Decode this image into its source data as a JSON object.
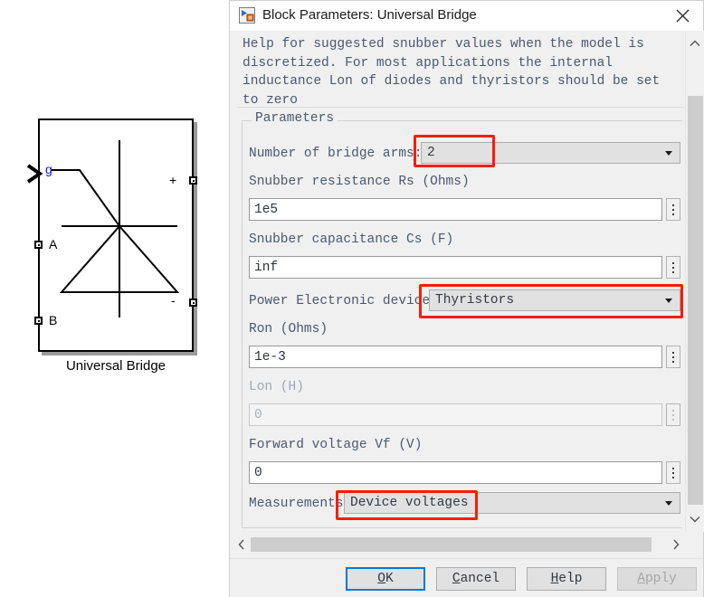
{
  "canvas": {
    "block": {
      "name": "Universal Bridge",
      "caption": "Universal Bridge",
      "ports": [
        {
          "label": "g",
          "type": "gate-input",
          "color": "#1111dd"
        },
        {
          "label": "A",
          "type": "ac-input"
        },
        {
          "label": "B",
          "type": "ac-input"
        },
        {
          "label": "+",
          "type": "dc-positive-output"
        },
        {
          "label": "-",
          "type": "dc-negative-output"
        }
      ],
      "symbol": "thyristor"
    }
  },
  "dialog": {
    "title": "Block Parameters: Universal Bridge",
    "title_icon": "simulink-block-icon",
    "close_icon": "close-icon",
    "help_text": "Help for suggested snubber values when the model is discretized. For most applications the internal inductance Lon of diodes and thyristors should be set to zero",
    "parameters_legend": "Parameters",
    "fields": {
      "bridge_arms": {
        "label": "Number of bridge arms:",
        "value": "2",
        "control": "dropdown",
        "highlighted": true
      },
      "snubber_resistance": {
        "label": "Snubber resistance Rs (Ohms)",
        "value": "1e5",
        "control": "text",
        "enabled": true
      },
      "snubber_capacitance": {
        "label": "Snubber capacitance Cs (F)",
        "value": "inf",
        "control": "text",
        "enabled": true
      },
      "power_electronic_device": {
        "label": "Power Electronic device",
        "value": "Thyristors",
        "control": "dropdown",
        "highlighted": true
      },
      "ron": {
        "label": "Ron (Ohms)",
        "value": "1e-3",
        "control": "text",
        "enabled": true
      },
      "lon": {
        "label": "Lon (H)",
        "value": "0",
        "control": "text",
        "enabled": false
      },
      "forward_voltage": {
        "label": "Forward voltage Vf (V)",
        "value": "0",
        "control": "text",
        "enabled": true
      },
      "measurements": {
        "label": "Measurements",
        "value": "Device voltages",
        "control": "dropdown",
        "highlighted": true
      }
    },
    "buttons": {
      "ok": {
        "label": "OK",
        "mnemonic": "O",
        "default": true,
        "enabled": true
      },
      "cancel": {
        "label": "Cancel",
        "mnemonic": "C",
        "enabled": true
      },
      "help": {
        "label": "Help",
        "mnemonic": "H",
        "enabled": true
      },
      "apply": {
        "label": "Apply",
        "mnemonic": "A",
        "enabled": false
      }
    },
    "scrollbars": {
      "vertical": {
        "up_icon": "chevron-up-icon",
        "down_icon": "chevron-down-icon"
      },
      "horizontal": {
        "left_icon": "chevron-left-icon",
        "right_icon": "chevron-right-icon"
      }
    }
  },
  "annotations": {
    "highlight_color": "#fe1a08",
    "boxes": [
      {
        "target": "bridge-arms-value"
      },
      {
        "target": "power-electronic-device-value"
      },
      {
        "target": "measurements-value"
      }
    ]
  }
}
